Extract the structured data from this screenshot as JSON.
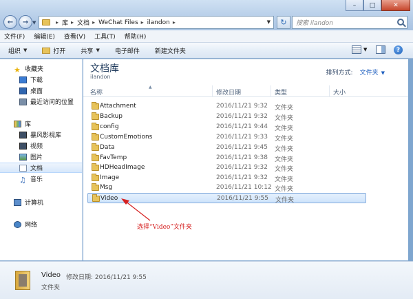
{
  "address": {
    "segments": [
      "库",
      "文档",
      "WeChat Files",
      "ilandon"
    ],
    "search_placeholder": "搜索 ilandon"
  },
  "menu": [
    "文件(F)",
    "编辑(E)",
    "查看(V)",
    "工具(T)",
    "帮助(H)"
  ],
  "toolbar": {
    "organize": "组织",
    "open": "打开",
    "share": "共享",
    "email": "电子邮件",
    "new_folder": "新建文件夹"
  },
  "navpane": {
    "favorites": "收藏夹",
    "downloads": "下载",
    "desktop": "桌面",
    "recent": "最近访问的位置",
    "libraries": "库",
    "storm_lib": "暴风影视库",
    "videos": "视频",
    "pictures": "图片",
    "documents": "文档",
    "music": "音乐",
    "computer": "计算机",
    "network": "网络"
  },
  "content": {
    "library_title": "文档库",
    "library_sub": "ilandon",
    "arrange_label": "排列方式:",
    "arrange_value": "文件夹",
    "columns": [
      "名称",
      "修改日期",
      "类型",
      "大小"
    ],
    "rows": [
      {
        "name": "Attachment",
        "date": "2016/11/21 9:32",
        "type": "文件夹"
      },
      {
        "name": "Backup",
        "date": "2016/11/21 9:32",
        "type": "文件夹"
      },
      {
        "name": "config",
        "date": "2016/11/21 9:44",
        "type": "文件夹"
      },
      {
        "name": "CustomEmotions",
        "date": "2016/11/21 9:33",
        "type": "文件夹"
      },
      {
        "name": "Data",
        "date": "2016/11/21 9:45",
        "type": "文件夹"
      },
      {
        "name": "FavTemp",
        "date": "2016/11/21 9:38",
        "type": "文件夹"
      },
      {
        "name": "HDHeadImage",
        "date": "2016/11/21 9:32",
        "type": "文件夹"
      },
      {
        "name": "Image",
        "date": "2016/11/21 9:32",
        "type": "文件夹"
      },
      {
        "name": "Msg",
        "date": "2016/11/21 10:12",
        "type": "文件夹"
      },
      {
        "name": "Video",
        "date": "2016/11/21 9:55",
        "type": "文件夹"
      }
    ],
    "annotation": "选择“Video”文件夹"
  },
  "details": {
    "name": "Video",
    "meta": "修改日期: 2016/11/21 9:55",
    "type": "文件夹"
  }
}
